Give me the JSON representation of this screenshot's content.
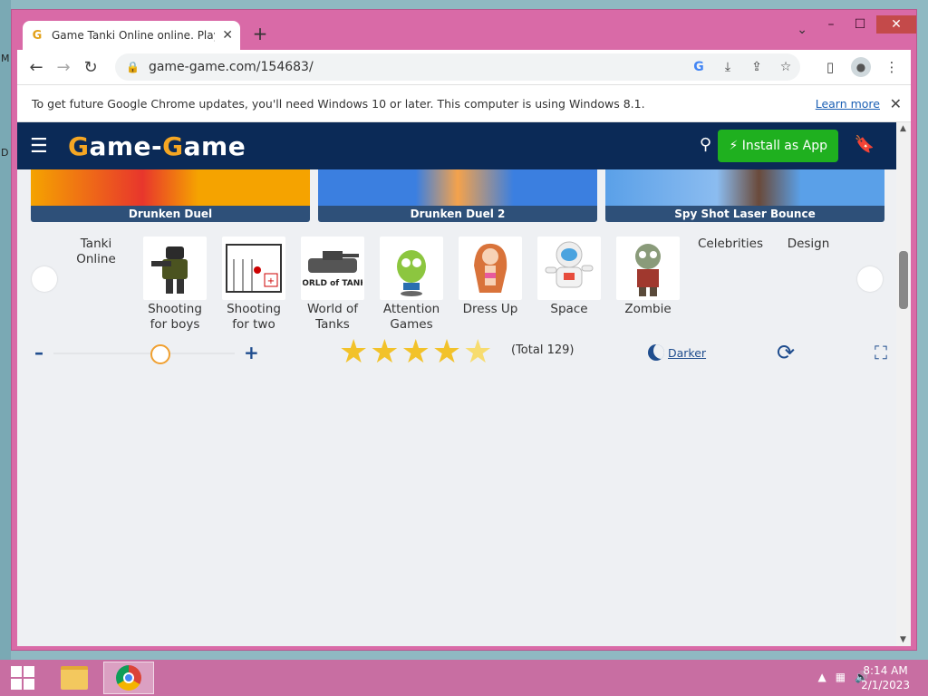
{
  "desktop": {
    "glyphs": [
      "M",
      "D"
    ]
  },
  "window": {
    "tab_title": "Game Tanki Online online. Play for free",
    "tab_favicon": "G",
    "new_tab": "+",
    "tab_search": "⌄",
    "minimize": "–",
    "maximize": "☐",
    "close": "✕"
  },
  "toolbar": {
    "back": "←",
    "forward": "→",
    "reload": "↻",
    "url": "game-game.com/154683/",
    "icons": [
      "google-icon",
      "download-icon",
      "share-icon",
      "star-icon",
      "sidebar-icon",
      "profile-icon",
      "menu-icon"
    ]
  },
  "infobar": {
    "message": "To get future Google Chrome updates, you'll need Windows 10 or later. This computer is using Windows 8.1.",
    "learn_more": "Learn more",
    "close": "✕"
  },
  "site": {
    "logo_g1": "G",
    "logo_mid": "ame-",
    "logo_g2": "G",
    "logo_end": "ame",
    "install_label": "⚡ Install as App"
  },
  "cards": [
    {
      "label": "Drunken Duel",
      "color": "#f5a300"
    },
    {
      "label": "Drunken Duel 2",
      "color": "#3b7fe0"
    },
    {
      "label": "Spy Shot Laser Bounce",
      "color": "#5aa0e8"
    }
  ],
  "categories": [
    {
      "label": "Tanki Online",
      "has_thumb": false
    },
    {
      "label": "Shooting for boys",
      "has_thumb": true
    },
    {
      "label": "Shooting for two",
      "has_thumb": true
    },
    {
      "label": "World of Tanks",
      "has_thumb": true
    },
    {
      "label": "Attention Games",
      "has_thumb": true
    },
    {
      "label": "Dress Up",
      "has_thumb": true
    },
    {
      "label": "Space",
      "has_thumb": true
    },
    {
      "label": "Zombie",
      "has_thumb": true
    },
    {
      "label": "Celebrities",
      "has_thumb": false
    },
    {
      "label": "Design",
      "has_thumb": false
    }
  ],
  "controls": {
    "zoom_minus": "–",
    "zoom_plus": "+",
    "zoom_level": 0.67,
    "rating": 4.5,
    "rating_total": "(Total 129)",
    "darker_label": "Darker"
  },
  "taskbar": {
    "time": "8:14 AM",
    "date": "2/1/2023"
  }
}
